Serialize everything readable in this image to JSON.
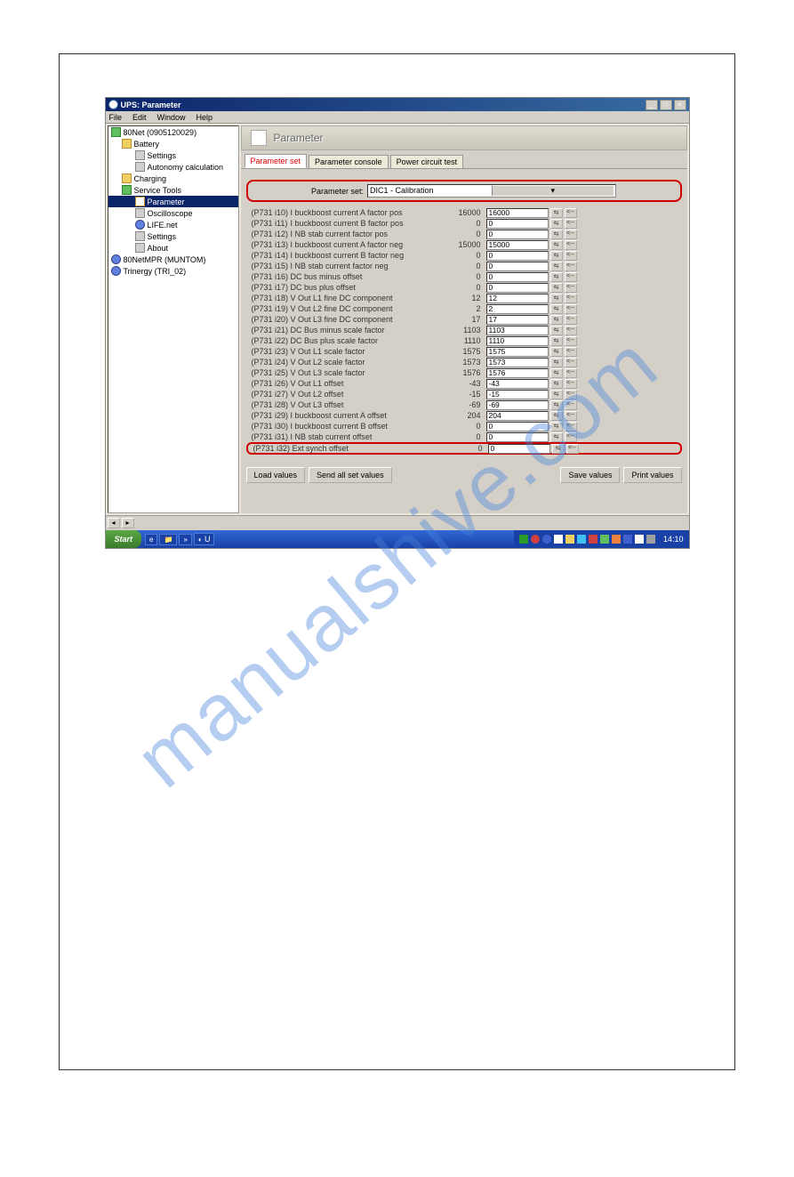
{
  "window": {
    "title": "UPS: Parameter"
  },
  "menu": {
    "file": "File",
    "edit": "Edit",
    "window": "Window",
    "help": "Help"
  },
  "tree": {
    "root": "80Net (0905120029)",
    "battery": "Battery",
    "settings1": "Settings",
    "autonomy": "Autonomy calculation",
    "charging": "Charging",
    "servicetools": "Service Tools",
    "parameter": "Parameter",
    "oscilloscope": "Oscilloscope",
    "lifenet": "LIFE.net",
    "settings2": "Settings",
    "about": "About",
    "netmpr": "80NetMPR (MUNTOM)",
    "trinergy": "Trinergy (TRI_02)"
  },
  "header": {
    "title": "Parameter"
  },
  "tabs": {
    "t1": "Parameter set",
    "t2": "Parameter console",
    "t3": "Power circuit test"
  },
  "paramset": {
    "label": "Parameter set:",
    "value": "DIC1 - Calibration"
  },
  "rows": [
    {
      "id": "(P731 i10)",
      "desc": "I buckboost current A factor pos",
      "cur": "16000",
      "val": "16000"
    },
    {
      "id": "(P731 i11)",
      "desc": "I buckboost current B factor pos",
      "cur": "0",
      "val": "0"
    },
    {
      "id": "(P731 i12)",
      "desc": "I NB stab current factor pos",
      "cur": "0",
      "val": "0"
    },
    {
      "id": "(P731 i13)",
      "desc": "I buckboost current A factor neg",
      "cur": "15000",
      "val": "15000"
    },
    {
      "id": "(P731 i14)",
      "desc": "I buckboost current B factor neg",
      "cur": "0",
      "val": "0"
    },
    {
      "id": "(P731 i15)",
      "desc": "I NB stab current factor neg",
      "cur": "0",
      "val": "0"
    },
    {
      "id": "(P731 i16)",
      "desc": "DC bus minus offset",
      "cur": "0",
      "val": "0"
    },
    {
      "id": "(P731 i17)",
      "desc": "DC bus plus offset",
      "cur": "0",
      "val": "0"
    },
    {
      "id": "(P731 i18)",
      "desc": "V Out L1 fine DC component",
      "cur": "12",
      "val": "12"
    },
    {
      "id": "(P731 i19)",
      "desc": "V Out L2 fine DC component",
      "cur": "2",
      "val": "2"
    },
    {
      "id": "(P731 i20)",
      "desc": "V Out L3 fine DC component",
      "cur": "17",
      "val": "17"
    },
    {
      "id": "(P731 i21)",
      "desc": "DC Bus minus scale factor",
      "cur": "1103",
      "val": "1103"
    },
    {
      "id": "(P731 i22)",
      "desc": "DC Bus plus scale factor",
      "cur": "1110",
      "val": "1110"
    },
    {
      "id": "(P731 i23)",
      "desc": "V Out L1 scale factor",
      "cur": "1575",
      "val": "1575"
    },
    {
      "id": "(P731 i24)",
      "desc": "V Out L2 scale factor",
      "cur": "1573",
      "val": "1573"
    },
    {
      "id": "(P731 i25)",
      "desc": "V Out L3 scale factor",
      "cur": "1576",
      "val": "1576"
    },
    {
      "id": "(P731 i26)",
      "desc": "V Out L1 offset",
      "cur": "-43",
      "val": "-43"
    },
    {
      "id": "(P731 i27)",
      "desc": "V Out L2 offset",
      "cur": "-15",
      "val": "-15"
    },
    {
      "id": "(P731 i28)",
      "desc": "V Out L3 offset",
      "cur": "-69",
      "val": "-69"
    },
    {
      "id": "(P731 i29)",
      "desc": "I buckboost current A offset",
      "cur": "204",
      "val": "204"
    },
    {
      "id": "(P731 i30)",
      "desc": "I buckboost current B offset",
      "cur": "0",
      "val": "0"
    },
    {
      "id": "(P731 i31)",
      "desc": "I NB stab current offset",
      "cur": "0",
      "val": "0"
    },
    {
      "id": "(P731 i32)",
      "desc": "Ext synch offset",
      "cur": "0",
      "val": "0"
    }
  ],
  "buttons": {
    "load": "Load values",
    "sendall": "Send all set values",
    "save": "Save values",
    "print": "Print values"
  },
  "taskbar": {
    "start": "Start",
    "task1": "U",
    "clock": "14:10"
  }
}
